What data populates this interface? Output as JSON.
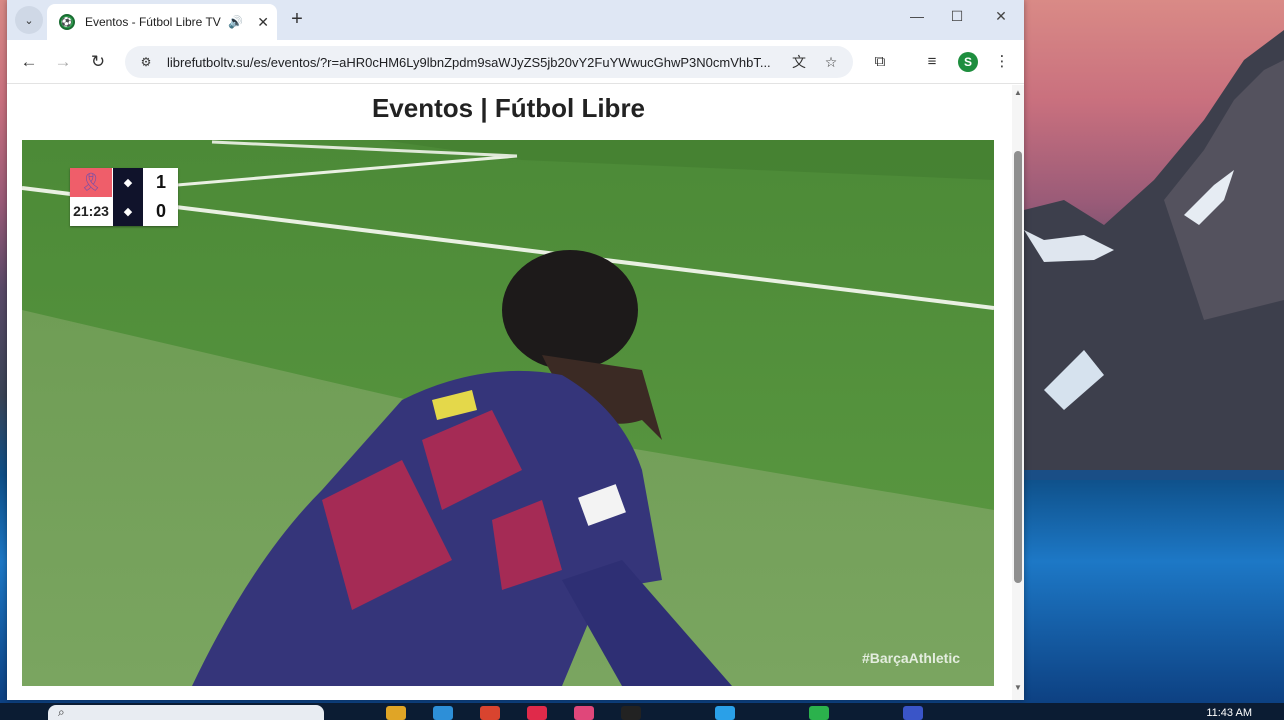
{
  "browser": {
    "tab": {
      "title": "Eventos - Fútbol Libre TV",
      "favicon": "soccer-ball-icon",
      "audio_icon": "speaker-icon"
    },
    "url": "librefutboltv.su/es/eventos/?r=aHR0cHM6Ly9lbnZpdm9saWJyZS5jb20vY2FuYWwucGhwP3N0cmVhbT...",
    "profile_initial": "S",
    "icons": {
      "back": "←",
      "forward": "→",
      "reload": "↻",
      "site_info": "⚙",
      "translate": "文",
      "bookmark": "☆",
      "extensions": "⧉",
      "media": "≡",
      "menu": "⋮",
      "new_tab": "+",
      "minimize": "—",
      "maximize": "☐",
      "close": "✕",
      "tab_close": "✕",
      "tab_search": "⌄"
    }
  },
  "page": {
    "title": "Eventos | Fútbol Libre"
  },
  "scoreboard": {
    "time": "21:23",
    "home_score": "1",
    "away_score": "0",
    "home_crest": "barcelona-crest-icon",
    "away_crest": "athletic-crest-icon",
    "ribbon": "awareness-ribbon-icon"
  },
  "video": {
    "hashtag": "#BarçaAthletic"
  },
  "taskbar": {
    "clock": "11:43 AM"
  },
  "colors": {
    "tabbar": "#dfe7f4",
    "ribbon_bg": "#ef5e6a",
    "crest_bg": "#10132b",
    "pitch": "#5f9c44"
  }
}
